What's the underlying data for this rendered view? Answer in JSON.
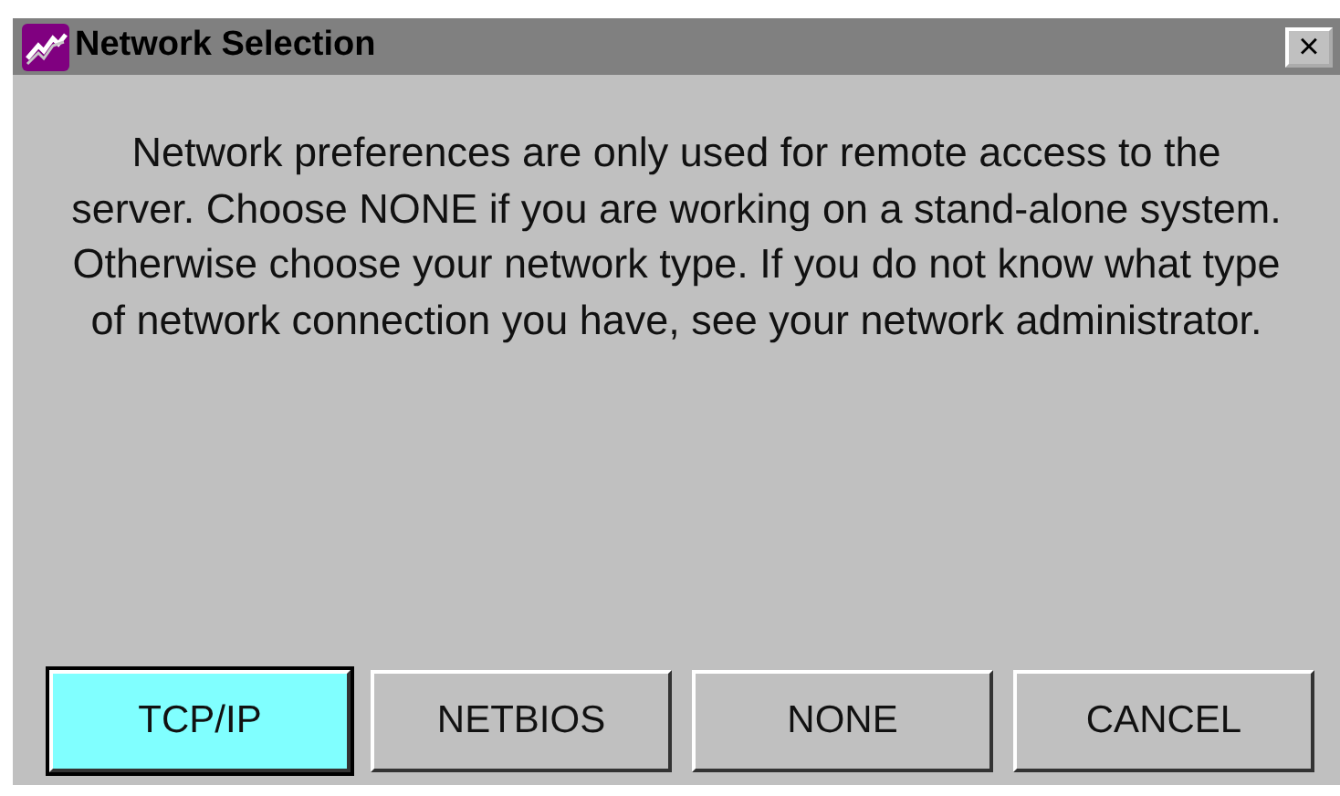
{
  "window": {
    "title": "Network Selection",
    "close": "×"
  },
  "message": "Network preferences are only used for remote access to the server.  Choose NONE if you are working on a stand-alone system. Otherwise choose your network type.  If you do not know what type of network connection you have, see your network administrator.",
  "buttons": [
    {
      "label": "TCP/IP",
      "selected": true
    },
    {
      "label": "NETBIOS",
      "selected": false
    },
    {
      "label": "NONE",
      "selected": false
    },
    {
      "label": "CANCEL",
      "selected": false
    }
  ]
}
